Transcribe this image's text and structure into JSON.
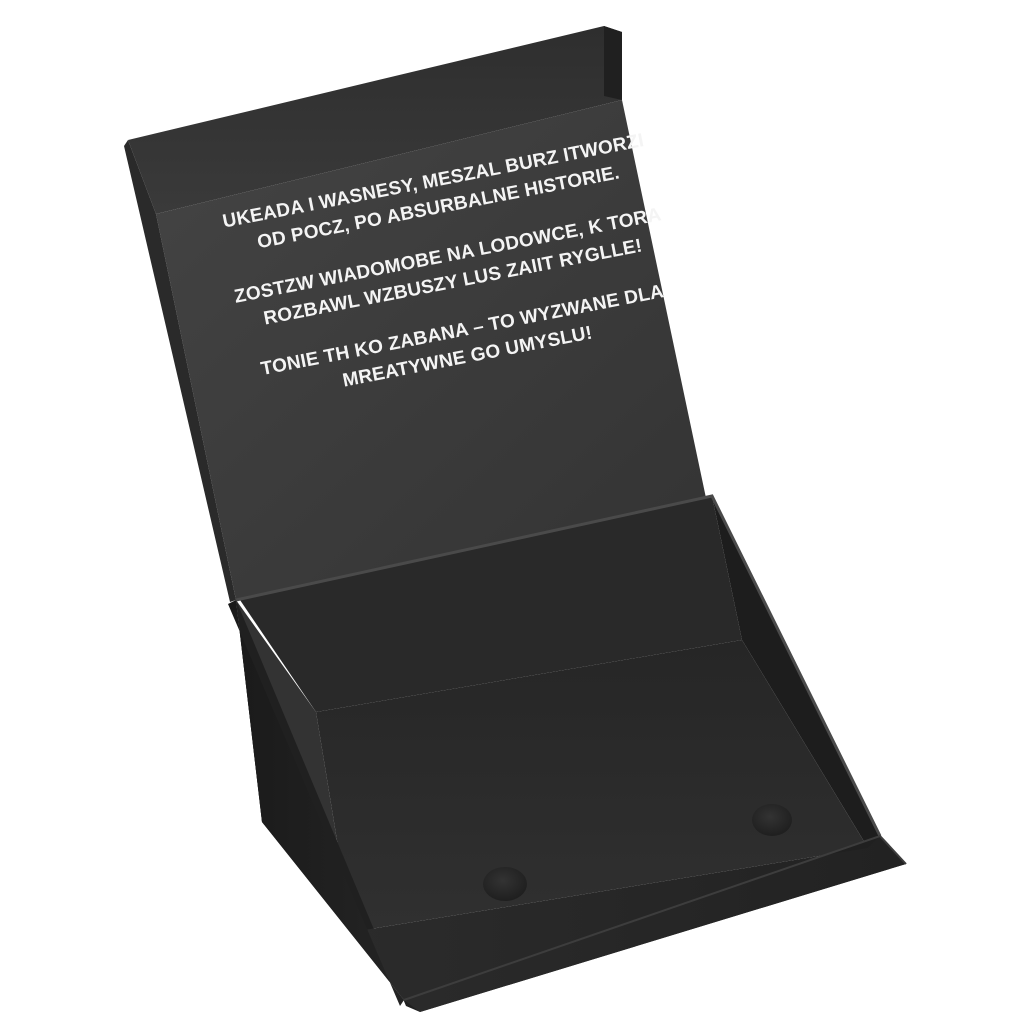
{
  "product": {
    "name": "black-magnetic-gift-box",
    "colors": {
      "box_outer_front": "#262626",
      "box_outer_side": "#1f1f1f",
      "box_top_edge": "#3a3a3a",
      "lid_inside": "#3b3b3b",
      "lid_edge": "#2a2a2a",
      "tray_back_wall": "#2a2a2a",
      "tray_left_wall": "#333333",
      "tray_right_wall": "#1c1c1c",
      "tray_floor": "#2e2e2e",
      "text_color": "#f4f4f4",
      "magnet_dot": "#2d2d2d"
    }
  },
  "lid_message": {
    "paragraphs": [
      {
        "lines": [
          "UKEADA I WASNESY, MESZAL BURZ ITWORZI",
          "OD POCZ, PO ABSURBALNE HISTORIE."
        ]
      },
      {
        "lines": [
          "ZOSTZW WIADOMOBE NA LODOWCE, K TORA",
          "ROZBAWL WZBUSZY LUS ZAIIT RYGLLE!"
        ]
      },
      {
        "lines": [
          "TONIE TH KO ZABANA – TO WYZWANE DLA",
          "MREATYWNE GO UMYSLU!"
        ]
      }
    ]
  }
}
